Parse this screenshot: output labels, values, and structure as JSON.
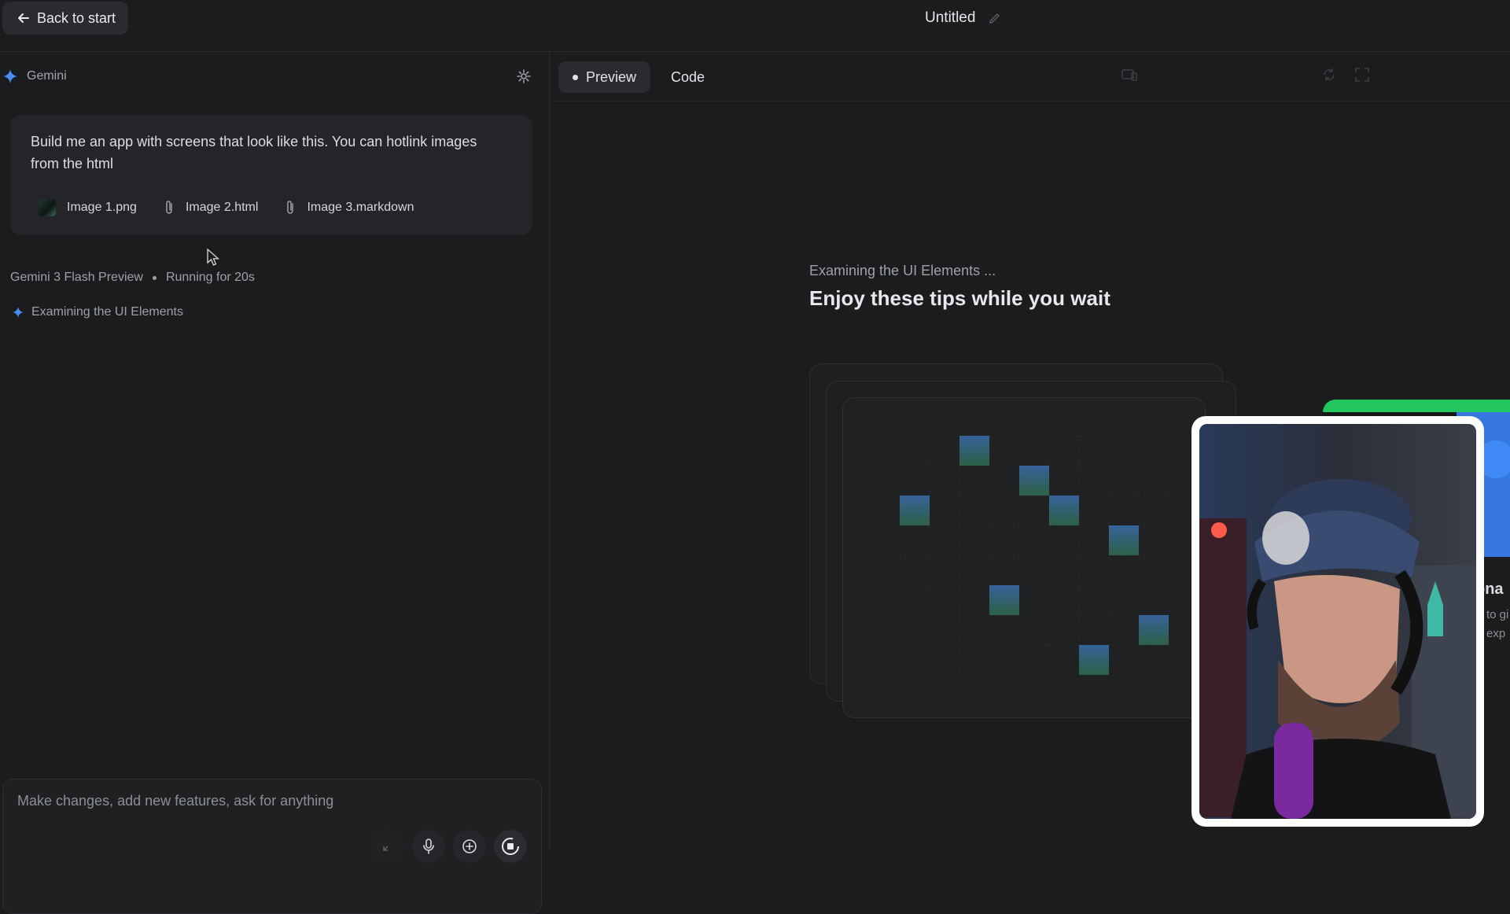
{
  "topbar": {
    "back_label": "Back to start",
    "project_title": "Untitled"
  },
  "left_panel": {
    "agent_label": "Gemini",
    "prompt": {
      "text": "Build me an app with screens that look like this. You can hotlink images from the html",
      "attachments": [
        {
          "name": "Image 1.png",
          "icon": "image-thumbnail-icon"
        },
        {
          "name": "Image 2.html",
          "icon": "paperclip-icon"
        },
        {
          "name": "Image 3.markdown",
          "icon": "paperclip-icon"
        }
      ]
    },
    "run_status": {
      "model": "Gemini 3 Flash Preview",
      "state": "Running for 20s"
    },
    "steps": [
      {
        "label": "Examining the UI Elements",
        "icon": "sparkle-icon"
      }
    ],
    "composer": {
      "placeholder": "Make changes, add new features, ask for anything",
      "tools": [
        "shrink-icon",
        "microphone-icon",
        "add-circle-icon",
        "stop-icon"
      ]
    }
  },
  "right_panel": {
    "tabs": [
      {
        "label": "Preview",
        "active": true
      },
      {
        "label": "Code",
        "active": false
      }
    ],
    "toolbar_icons": [
      "device-icon",
      "refresh-icon",
      "fullscreen-icon"
    ],
    "loading": {
      "subtitle": "Examining the UI Elements ...",
      "title": "Enjoy these tips while you wait"
    },
    "tip_card_peek": {
      "heading_fragment": "ona",
      "line_fragments": [
        "to gi",
        "exp"
      ]
    }
  },
  "colors": {
    "background": "#1b1c1e",
    "panel": "#242528",
    "accent_blue": "#4a8cf7",
    "accent_green": "#22c55e"
  }
}
